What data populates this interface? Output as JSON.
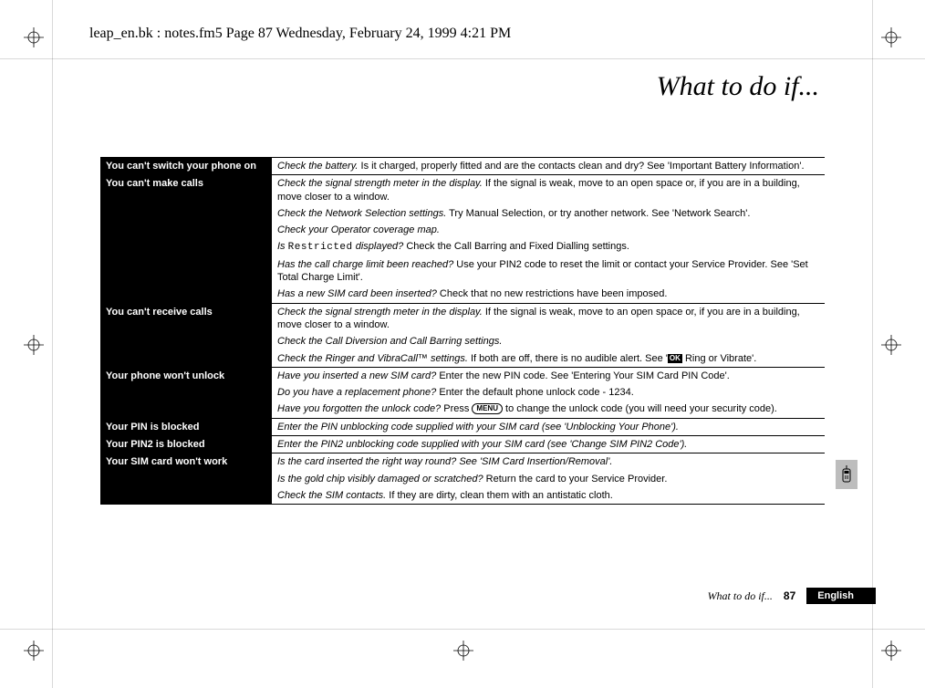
{
  "header": "leap_en.bk : notes.fm5  Page 87  Wednesday, February 24, 1999  4:21 PM",
  "title": "What to do if...",
  "rows": [
    {
      "cat": "You can't switch your phone on",
      "lines": [
        [
          {
            "i": true,
            "t": "Check the battery."
          },
          {
            "t": " Is it charged, properly fitted and are the contacts clean and dry? See 'Important Battery Information'."
          }
        ]
      ]
    },
    {
      "cat": "You can't make calls",
      "lines": [
        [
          {
            "i": true,
            "t": "Check the signal strength meter in the display."
          },
          {
            "t": " If the signal is weak, move to an open space or, if you are in a building, move closer to a window."
          }
        ],
        [
          {
            "i": true,
            "t": "Check the Network Selection settings."
          },
          {
            "t": " Try Manual Selection, or try another network. See 'Network Search'."
          }
        ],
        [
          {
            "i": true,
            "t": "Check your Operator coverage map."
          }
        ],
        [
          {
            "i": true,
            "t": "Is "
          },
          {
            "mono": true,
            "t": "Restricted"
          },
          {
            "i": true,
            "t": " displayed?"
          },
          {
            "t": " Check the Call Barring and Fixed Dialling settings."
          }
        ],
        [
          {
            "i": true,
            "t": "Has the call charge limit been reached?"
          },
          {
            "t": " Use your PIN2 code to reset the limit or contact your Service Provider. See 'Set Total Charge Limit'."
          }
        ],
        [
          {
            "i": true,
            "t": "Has a new SIM card been inserted?"
          },
          {
            "t": " Check that no new restrictions have been imposed."
          }
        ]
      ]
    },
    {
      "cat": "You can't receive calls",
      "lines": [
        [
          {
            "i": true,
            "t": "Check the signal strength meter in the display."
          },
          {
            "t": " If the signal is weak, move to an open space or, if you are in a building, move closer to a window."
          }
        ],
        [
          {
            "i": true,
            "t": "Check the Call Diversion and Call Barring settings."
          }
        ],
        [
          {
            "i": true,
            "t": "Check the Ringer and VibraCall™ settings."
          },
          {
            "t": " If both are off, there is no audible alert. See '"
          },
          {
            "ok": true,
            "t": "OK"
          },
          {
            "t": " Ring or Vibrate'."
          }
        ]
      ]
    },
    {
      "cat": "Your phone won't unlock",
      "lines": [
        [
          {
            "i": true,
            "t": "Have you inserted a new SIM card?"
          },
          {
            "t": " Enter the new PIN code. See 'Entering Your SIM Card PIN Code'."
          }
        ],
        [
          {
            "i": true,
            "t": "Do you have a replacement phone?"
          },
          {
            "t": " Enter the default phone unlock code - 1234."
          }
        ],
        [
          {
            "i": true,
            "t": "Have you forgotten the unlock code?"
          },
          {
            "t": " Press "
          },
          {
            "menu": true,
            "t": "MENU"
          },
          {
            "t": " to change the unlock code (you will need your security code)."
          }
        ]
      ]
    },
    {
      "cat": "Your PIN is blocked",
      "lines": [
        [
          {
            "i": true,
            "t": "Enter the PIN unblocking code supplied with your SIM card (see 'Unblocking Your Phone')."
          }
        ]
      ]
    },
    {
      "cat": "Your PIN2 is blocked",
      "lines": [
        [
          {
            "i": true,
            "t": "Enter the PIN2 unblocking code supplied with your SIM card (see 'Change SIM PIN2 Code')."
          }
        ]
      ]
    },
    {
      "cat": "Your SIM card won't work",
      "lines": [
        [
          {
            "i": true,
            "t": "Is the card inserted the right way round? See 'SIM Card Insertion/Removal'."
          }
        ],
        [
          {
            "i": true,
            "t": "Is the gold chip visibly damaged or scratched?"
          },
          {
            "t": " Return the card to your Service Provider."
          }
        ],
        [
          {
            "i": true,
            "t": "Check the SIM contacts."
          },
          {
            "t": " If they are dirty, clean them with an antistatic cloth."
          }
        ]
      ]
    }
  ],
  "footer": {
    "section": "What to do if...",
    "page": "87",
    "language": "English"
  }
}
